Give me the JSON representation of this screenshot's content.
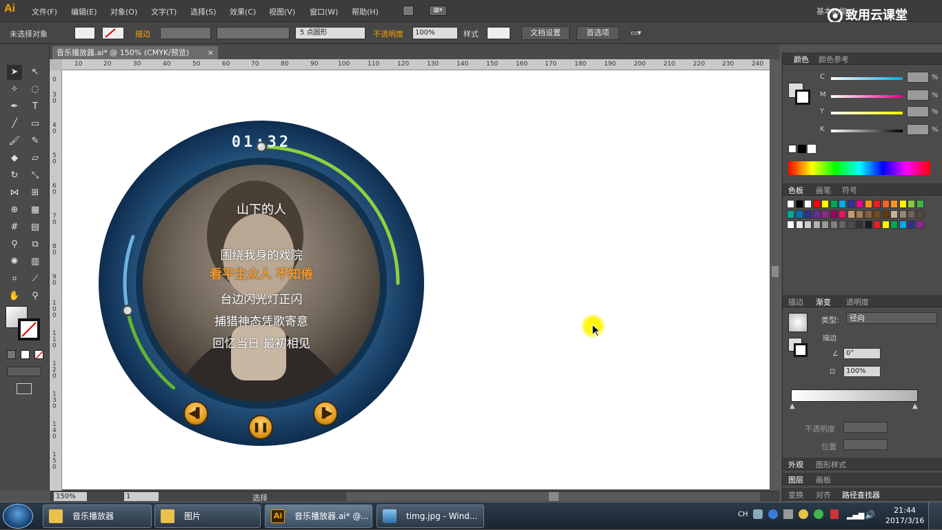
{
  "app": {
    "logo": "Ai",
    "menus": [
      "文件(F)",
      "编辑(E)",
      "对象(O)",
      "文字(T)",
      "选择(S)",
      "效果(C)",
      "视图(V)",
      "窗口(W)",
      "帮助(H)"
    ],
    "workspace": "基本功能",
    "watermark": "致用云课堂"
  },
  "control_bar": {
    "selection": "未选择对象",
    "stroke_label": "描边",
    "stroke_value": "",
    "brush": "5 点圆形",
    "opacity_label": "不透明度",
    "opacity_value": "100%",
    "style_label": "样式",
    "doc_setup": "文档设置",
    "preferences": "首选项"
  },
  "document": {
    "tab_title": "音乐播放器.ai* @ 150% (CMYK/预览)",
    "close": "×"
  },
  "rulers": {
    "h_ticks": [
      "10",
      "20",
      "30",
      "40",
      "50",
      "60",
      "70",
      "80",
      "90",
      "100",
      "110",
      "120",
      "130",
      "140",
      "150",
      "160",
      "170",
      "180",
      "190",
      "200",
      "210",
      "220",
      "230",
      "240"
    ],
    "v_ticks": [
      "3\n0",
      "4\n0",
      "5\n0",
      "6\n0",
      "7\n0",
      "8\n0",
      "9\n0",
      "1\n0\n0",
      "1\n1\n0",
      "1\n2\n0",
      "1\n3\n0",
      "1\n4\n0",
      "1\n5\n0"
    ],
    "zero": "0"
  },
  "player": {
    "time": "01:32",
    "song_title": "山下的人",
    "progress": 0.25,
    "volume": 0.55,
    "lyrics": [
      {
        "text": "围绕我身的戏院",
        "highlight": false
      },
      {
        "text": "看平生众人 不知倦",
        "highlight": true
      },
      {
        "text": "台边闪光灯正闪",
        "highlight": false
      },
      {
        "text": "捕猎神态凭歌寄意",
        "highlight": false
      },
      {
        "text": "回忆当日 最初相见",
        "highlight": false
      }
    ],
    "prev_icon": "prev-icon",
    "pause_icon": "pause-icon",
    "next_icon": "next-icon"
  },
  "status_bar": {
    "zoom": "150%",
    "page": "1",
    "tool": "选择"
  },
  "right_panels": {
    "color_tabs": [
      "颜色",
      "颜色参考"
    ],
    "cmyk": [
      {
        "label": "C",
        "unit": "%"
      },
      {
        "label": "M",
        "unit": "%"
      },
      {
        "label": "Y",
        "unit": "%"
      },
      {
        "label": "K",
        "unit": "%"
      }
    ],
    "swatch_tabs": [
      "色板",
      "画笔",
      "符号"
    ],
    "gradient_tabs": [
      "描边",
      "渐变",
      "透明度"
    ],
    "gradient_type_label": "类型:",
    "gradient_type_value": "径向",
    "gradient_stroke_label": "描边",
    "angle": "0°",
    "aspect": "100%",
    "gradient_opacity_label": "不透明度",
    "gradient_position_label": "位置",
    "appearance_tabs": [
      "外观",
      "图形样式"
    ],
    "layers_tabs": [
      "图层",
      "画板"
    ],
    "bottom_tabs": [
      "变换",
      "对齐",
      "路径查找器"
    ],
    "accent": "#f7a100"
  },
  "taskbar": {
    "tasks": [
      {
        "label": "音乐播放器",
        "icon": "folder-icon"
      },
      {
        "label": "图片",
        "icon": "folder-icon"
      },
      {
        "label": "音乐播放器.ai* @...",
        "icon": "illustrator-icon"
      },
      {
        "label": "timg.jpg - Wind...",
        "icon": "image-viewer-icon"
      }
    ],
    "lang": "CH",
    "time": "21:44",
    "date": "2017/3/16"
  }
}
